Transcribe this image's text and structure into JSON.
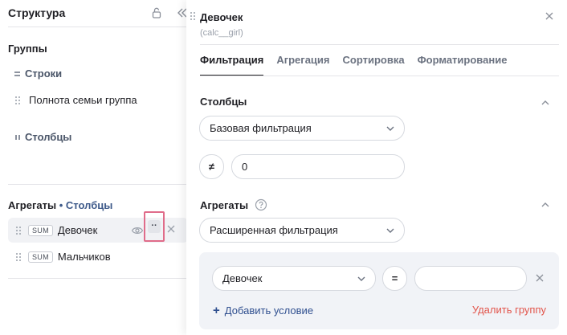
{
  "left_panel": {
    "title": "Структура",
    "groups_label": "Группы",
    "rows_label": "Строки",
    "row_items": [
      "Полнота семьи группа"
    ],
    "columns_label": "Столбцы",
    "aggregates_label": "Агрегаты",
    "aggregates_separator": "•",
    "aggregates_target": "Столбцы",
    "aggregates": [
      {
        "func": "SUM",
        "name": "Девочек",
        "active": true
      },
      {
        "func": "SUM",
        "name": "Мальчиков",
        "active": false
      }
    ],
    "more_glyph": "··"
  },
  "right_panel": {
    "title": "Девочек",
    "subtitle": "(calc__girl)",
    "tabs": [
      {
        "label": "Фильтрация",
        "active": true
      },
      {
        "label": "Агрегация",
        "active": false
      },
      {
        "label": "Сортировка",
        "active": false
      },
      {
        "label": "Форматирование",
        "active": false
      }
    ],
    "columns_block": {
      "title": "Столбцы",
      "filter_type": "Базовая фильтрация",
      "operator": "≠",
      "value": "0"
    },
    "aggregates_block": {
      "title": "Агрегаты",
      "filter_type": "Расширенная фильтрация",
      "condition": {
        "field": "Девочек",
        "operator": "=",
        "value": ""
      },
      "add_condition_label": "Добавить условие",
      "add_condition_glyph": "+",
      "delete_group_label": "Удалить группу"
    }
  },
  "colors": {
    "accent": "#3e5a8a",
    "link": "#2f4f8f",
    "danger": "#e2554b",
    "highlight_border": "#e06c8a"
  }
}
